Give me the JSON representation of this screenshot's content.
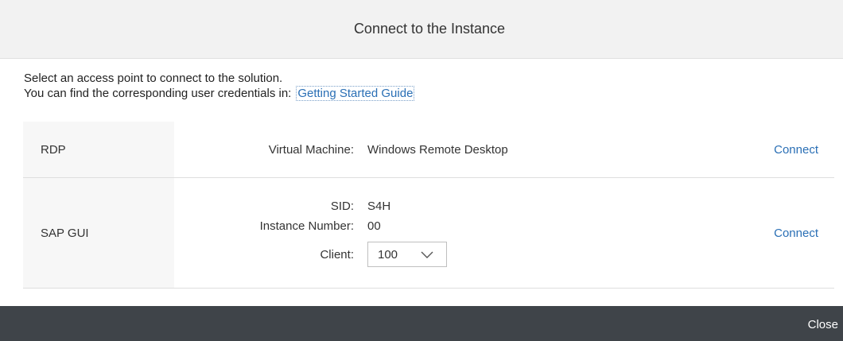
{
  "dialog": {
    "title": "Connect to the Instance",
    "intro_line1": "Select an access point to connect to the solution.",
    "intro_line2": "You can find the corresponding user credentials in:",
    "guide_link": "Getting Started Guide"
  },
  "rows": [
    {
      "name": "RDP",
      "label": "Virtual Machine:",
      "value": "Windows Remote Desktop",
      "action": "Connect"
    },
    {
      "name": "SAP GUI",
      "sid_label": "SID:",
      "sid_value": "S4H",
      "instance_label": "Instance Number:",
      "instance_value": "00",
      "client_label": "Client:",
      "client_value": "100",
      "action": "Connect"
    }
  ],
  "footer": {
    "close_label": "Close"
  },
  "colors": {
    "link": "#2a6fb5",
    "footer": "#3f4449",
    "header": "#f2f2f2"
  },
  "icons": {
    "dropdown": "chevron-down-icon"
  }
}
